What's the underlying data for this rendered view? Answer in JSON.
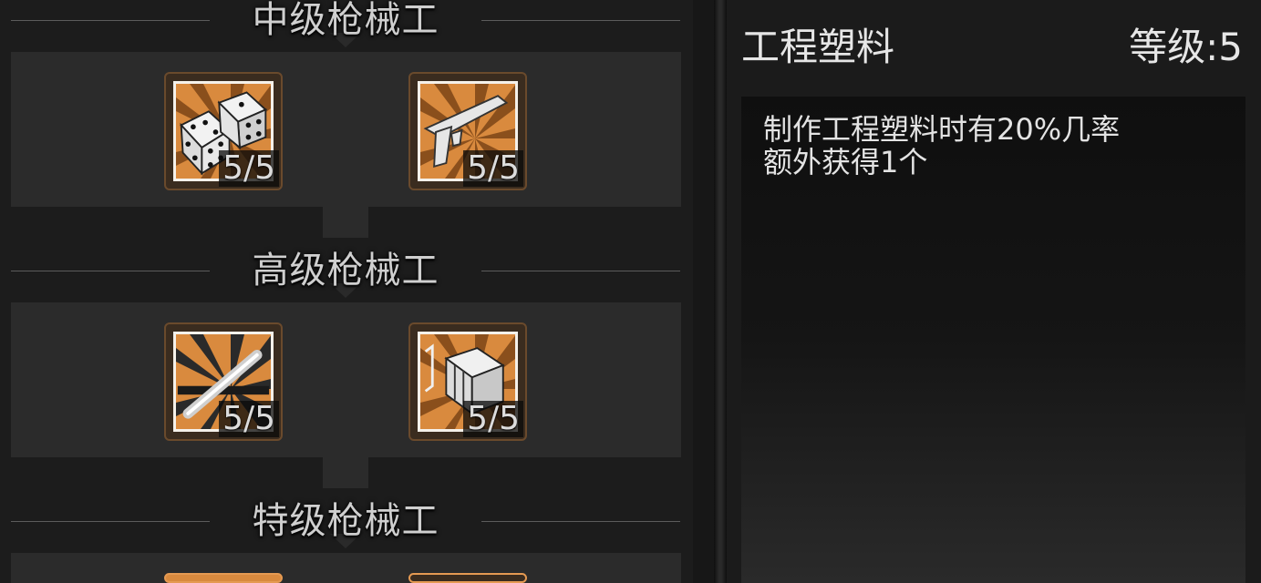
{
  "tiers": [
    {
      "title": "中级枪械工",
      "skills": [
        {
          "icon": "dice-icon",
          "rank": "5/5"
        },
        {
          "icon": "pistol-icon",
          "rank": "5/5"
        }
      ]
    },
    {
      "title": "高级枪械工",
      "skills": [
        {
          "icon": "metal-rod-icon",
          "rank": "5/5"
        },
        {
          "icon": "crate-icon",
          "rank": "5/5"
        }
      ]
    },
    {
      "title": "特级枪械工",
      "skills": []
    }
  ],
  "detail": {
    "name": "工程塑料",
    "level_label": "等级:5",
    "description_line1": "制作工程塑料时有20%几率",
    "description_line2": "额外获得1个"
  },
  "colors": {
    "accent_orange": "#d98a3e",
    "panel": "#2b2b2b",
    "text": "#e3e3e3"
  }
}
